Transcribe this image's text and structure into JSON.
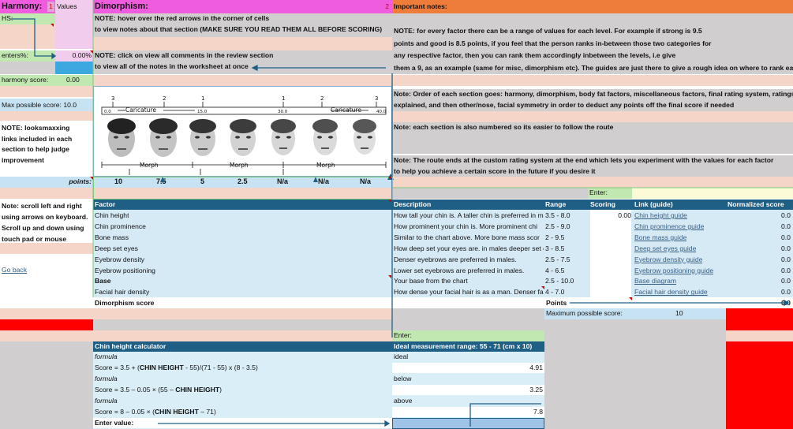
{
  "harmony": {
    "title": "Harmony:",
    "index": "1",
    "values_header": "Values",
    "hs_label": "HS:",
    "enters_label": "enters%:",
    "enters_value": "0.00%",
    "score_label": "harmony score:",
    "score_value": "0.00",
    "max_label": "Max possible score: 10.0",
    "note_links": [
      "NOTE: looksmaxxing",
      "links included in each",
      "section to help judge",
      "improvement"
    ],
    "points_label": "points:",
    "note_scroll": [
      "Note: scroll left and right",
      "using arrows on keyboard.",
      "Scroll up and down using",
      "touch pad or mouse"
    ],
    "go_back": "Go back"
  },
  "dimorphism": {
    "title": "Dimorphism:",
    "index": "2",
    "note1_line1": "NOTE: hover over the red arrows in the corner of cells",
    "note1_line2": "to view notes about that section (MAKE SURE YOU READ THEM ALL BEFORE SCORING)",
    "note2_line1": "NOTE: click on view all comments in the review section",
    "note2_line2": "to view all of the notes in the worksheet at once",
    "chart": {
      "top_numbers": [
        "3",
        "2",
        "1",
        "1",
        "2",
        "3"
      ],
      "caricature_label": "Caricature",
      "scale_marks": [
        "0.0",
        "15.0",
        "30.0",
        "40.0"
      ],
      "morph_label": "Morph"
    },
    "points_values": [
      "10",
      "7.5",
      "5",
      "2.5",
      "N/a",
      "N/a",
      "N/a"
    ]
  },
  "important": {
    "title": "Important notes:",
    "lines": [
      "NOTE: for every factor there can be a range of values for each level. For example if strong is 9.5",
      "points and good is 8.5 points, if you feel that the person ranks in-between those two categories for",
      "any respective factor, then you can rank them accordingly inbetween the levels, i.e give",
      "them a 9, as an example (same for misc, dimorphism etc). The guides are just there to give a rough idea on where to rank each f",
      "Note: Order of each section goes: harmony, dimorphism, body fat factors, miscellaneous factors, final rating system, ratings",
      "explained, and then other/nose, facial symmetry in order to deduct any points off the final score if needed",
      "Note: each section is also numbered so its easier to follow the route",
      "Note: The route ends at the custom rating system at the end which lets you experiment with the values for each factor",
      "to help you achieve a certain score in the future if you desire it"
    ]
  },
  "enter_label": "Enter:",
  "table": {
    "headers": {
      "factor": "Factor",
      "description": "Description",
      "range": "Range",
      "scoring": "Scoring",
      "link": "Link (guide)",
      "normalized": "Normalized score"
    },
    "rows": [
      {
        "factor": "Chin height",
        "description": "How tall your chin is. A taller chin is preferred in m",
        "range": "3.5 - 8.0",
        "scoring": "0.00",
        "link": "Chin height guide",
        "normalized": "0.0"
      },
      {
        "factor": "Chin prominence",
        "description": "How prominent your chin is. More prominent chi",
        "range": "2.5 - 9.0",
        "scoring": "",
        "link": "Chin prominence guide",
        "normalized": "0.0"
      },
      {
        "factor": "Bone mass",
        "description": "Similar to the chart above. More bone mass scor",
        "range": "2 - 9.5",
        "scoring": "",
        "link": "Bone mass guide",
        "normalized": "0.0"
      },
      {
        "factor": "Deep set eyes",
        "description": "How deep set your eyes are. in males deeper set e",
        "range": "3 - 8.5",
        "scoring": "",
        "link": "Deep set eyes guide",
        "normalized": "0.0"
      },
      {
        "factor": "Eyebrow density",
        "description": "Denser eyebrows are preferred in males.",
        "range": "2.5 - 7.5",
        "scoring": "",
        "link": "Eyebrow density guide",
        "normalized": "0.0"
      },
      {
        "factor": "Eyebrow positioning",
        "description": "Lower set eyebrows are preferred in males.",
        "range": "4 - 6.5",
        "scoring": "",
        "link": "Eyebrow positioning guide",
        "normalized": "0.0"
      },
      {
        "factor": "Base",
        "description": "Your base from the chart",
        "range": "2.5 - 10.0",
        "scoring": "",
        "link": "Base diagram",
        "normalized": "0.0"
      },
      {
        "factor": "Facial hair density",
        "description": "How dense your facial hair is as a man. Denser fa",
        "range": "4 - 7.0",
        "scoring": "",
        "link": "Facial hair density guide",
        "normalized": "0.0"
      }
    ],
    "score_label": "Dimorphism score",
    "points_label": "Points",
    "points_value": "0.0",
    "max_label": "Maximum possible score:",
    "max_value": "10"
  },
  "calc": {
    "title": "Chin height calculator",
    "range_title": "Ideal measurement range: 55 - 71 (cm x 10)",
    "formula_label": "formula",
    "ideal_label": "ideal",
    "below_label": "below",
    "above_label": "above",
    "formula1_pre": "Score = 3.5 + (",
    "formula1_bold": "CHIN HEIGHT",
    "formula1_post": " - 55)/(71 - 55) x (8 - 3.5)",
    "formula2_pre": "Score = 3.5 – 0.05 × (55 – ",
    "formula2_bold": "CHIN HEIGHT",
    "formula2_post": ")",
    "formula3_pre": "Score = 8 – 0.05 × (",
    "formula3_bold": "CHIN HEIGHT",
    "formula3_post": " – 71)",
    "ideal_value": "4.91",
    "below_value": "3.25",
    "above_value": "7.8",
    "enter_value_label": "Enter value:"
  },
  "colors": {
    "accent": "#1f5f86",
    "harmony": "#ef5cdd",
    "important": "#ee7d3b",
    "alert": "#ff0000"
  }
}
